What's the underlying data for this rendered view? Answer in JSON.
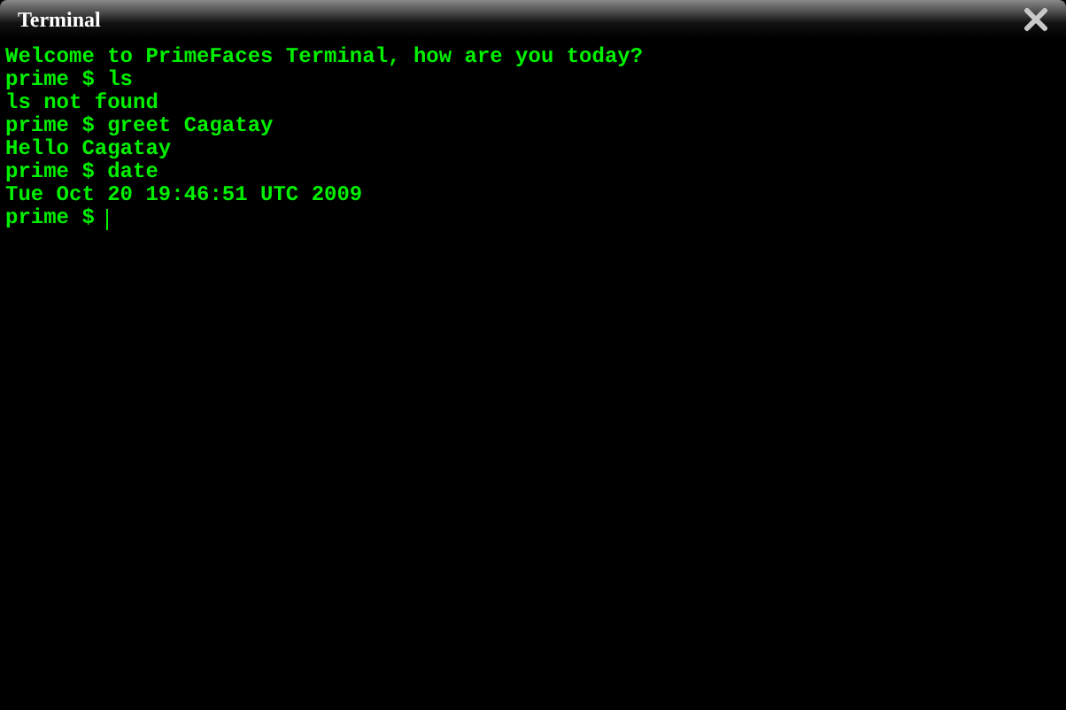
{
  "window": {
    "title": "Terminal"
  },
  "terminal": {
    "lines": [
      "Welcome to PrimeFaces Terminal, how are you today?",
      "prime $ ls",
      "ls not found",
      "prime $ greet Cagatay",
      "Hello Cagatay",
      "prime $ date",
      "Tue Oct 20 19:46:51 UTC 2009"
    ],
    "prompt": "prime $"
  }
}
